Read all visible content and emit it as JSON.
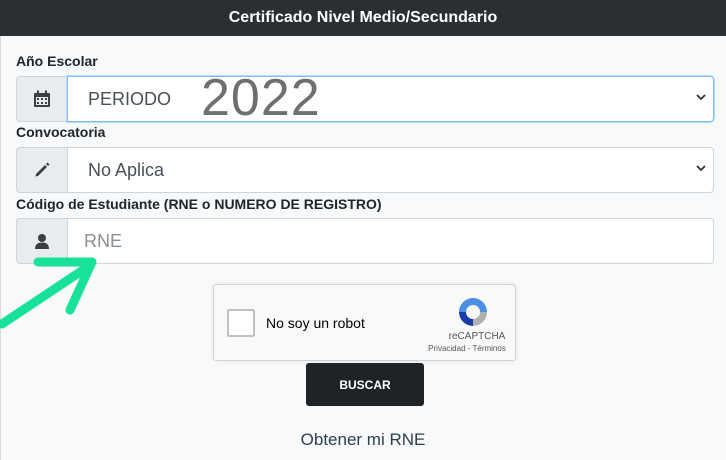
{
  "header": {
    "title": "Certificado Nivel Medio/Secundario"
  },
  "year_field": {
    "label": "Año Escolar",
    "value": "PERIODO",
    "overlay_text": "2022",
    "icon": "calendar-icon"
  },
  "convocatoria_field": {
    "label": "Convocatoria",
    "value": "No Aplica",
    "icon": "pencil-icon"
  },
  "student_field": {
    "label": "Código de Estudiante (RNE o NUMERO DE REGISTRO)",
    "placeholder": "RNE",
    "icon": "user-icon"
  },
  "captcha": {
    "label": "No soy un robot",
    "brand": "reCAPTCHA",
    "links": "Privacidad - Términos"
  },
  "search_button": {
    "label": "BUSCAR"
  },
  "rne_link": {
    "label": "Obtener mi RNE"
  },
  "colors": {
    "header_bg": "#2b2f33",
    "button_bg": "#1f2327",
    "arrow": "#18e29a",
    "focus_border": "#80bdff"
  }
}
